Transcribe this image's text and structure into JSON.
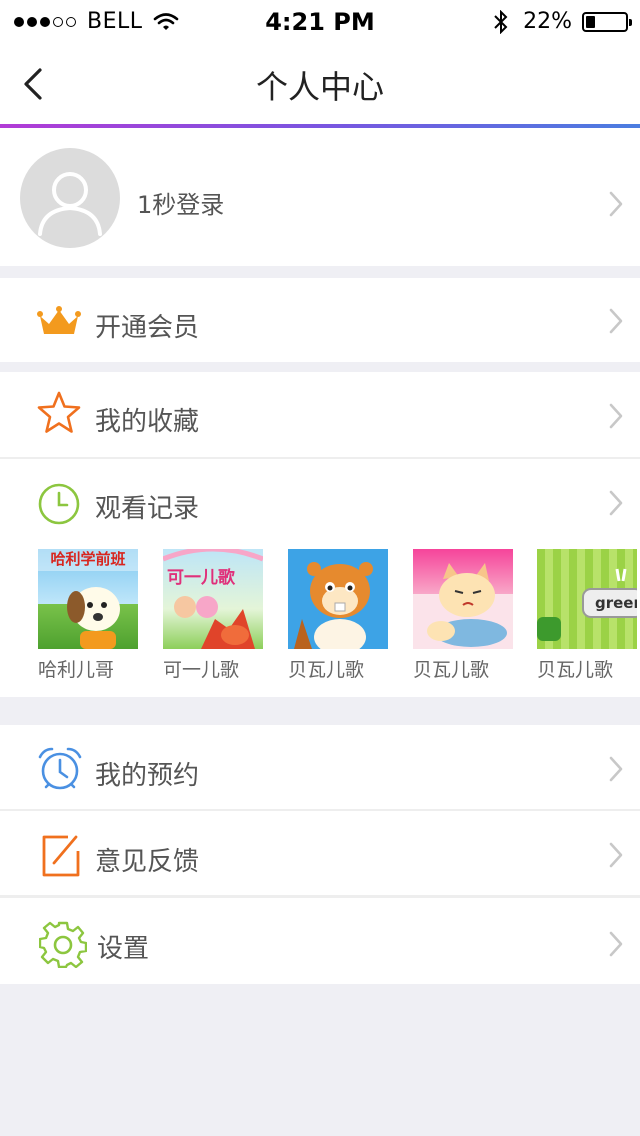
{
  "status_bar": {
    "carrier": "BELL",
    "time": "4:21 PM",
    "battery": "22%"
  },
  "nav": {
    "title": "个人中心"
  },
  "profile": {
    "login_label": "1秒登录"
  },
  "menu": {
    "vip": "开通会员",
    "favorites": "我的收藏",
    "history": "观看记录",
    "reservations": "我的预约",
    "feedback": "意见反馈",
    "settings": "设置"
  },
  "history_items": [
    {
      "caption": "哈利儿哥",
      "banner": "哈利学前班"
    },
    {
      "caption": "可一儿歌",
      "banner": "可一儿歌"
    },
    {
      "caption": "贝瓦儿歌"
    },
    {
      "caption": "贝瓦儿歌"
    },
    {
      "caption": "贝瓦儿歌",
      "banner": "green"
    }
  ],
  "colors": {
    "accent_orange": "#f39a1e",
    "icon_orange": "#f0701e",
    "icon_green": "#8cc63f",
    "icon_blue": "#4a90e2"
  }
}
